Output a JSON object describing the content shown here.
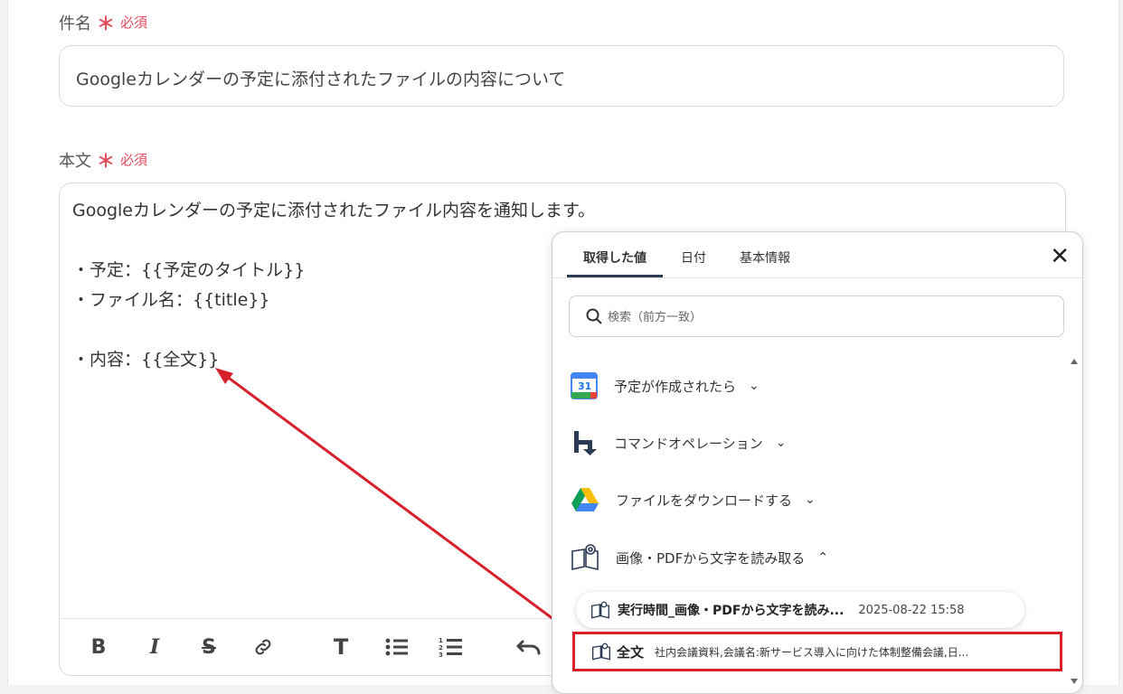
{
  "subject": {
    "label": "件名",
    "required_mark": "＊",
    "required_text": "必須",
    "value": "Googleカレンダーの予定に添付されたファイルの内容について"
  },
  "body": {
    "label": "本文",
    "required_mark": "＊",
    "required_text": "必須",
    "value": "Googleカレンダーの予定に添付されたファイル内容を通知します。\n\n・予定：{{予定のタイトル}}\n・ファイル名：{{title}}\n\n・内容：{{全文}}"
  },
  "toolbar": {
    "bold": "B",
    "italic": "I",
    "strike": "S",
    "heading": "T"
  },
  "popup": {
    "tabs": [
      "取得した値",
      "日付",
      "基本情報"
    ],
    "active_tab": "取得した値",
    "close": "✕",
    "search_placeholder": "検索（前方一致）",
    "groups": [
      {
        "label": "予定が作成されたら",
        "icon": "google-calendar-icon",
        "expanded": false,
        "chevron": "⌄"
      },
      {
        "label": "コマンドオペレーション",
        "icon": "command-operation-icon",
        "expanded": false,
        "chevron": "⌄"
      },
      {
        "label": "ファイルをダウンロードする",
        "icon": "google-drive-icon",
        "expanded": false,
        "chevron": "⌄"
      },
      {
        "label": "画像・PDFから文字を読み取る",
        "icon": "ocr-book-icon",
        "expanded": true,
        "chevron": "⌃"
      }
    ],
    "exec_item": {
      "name": "実行時間_画像・PDFから文字を読み...",
      "value": "2025-08-22 15:58"
    },
    "full_text_item": {
      "name": "全文",
      "value": "社内会議資料,会議名:新サービス導入に向けた体制整備会議,日..."
    }
  },
  "colors": {
    "required": "#e64b5c",
    "highlight_border": "#d8202b",
    "arrow": "#d8202b",
    "tab_underline": "#2b3a55"
  }
}
